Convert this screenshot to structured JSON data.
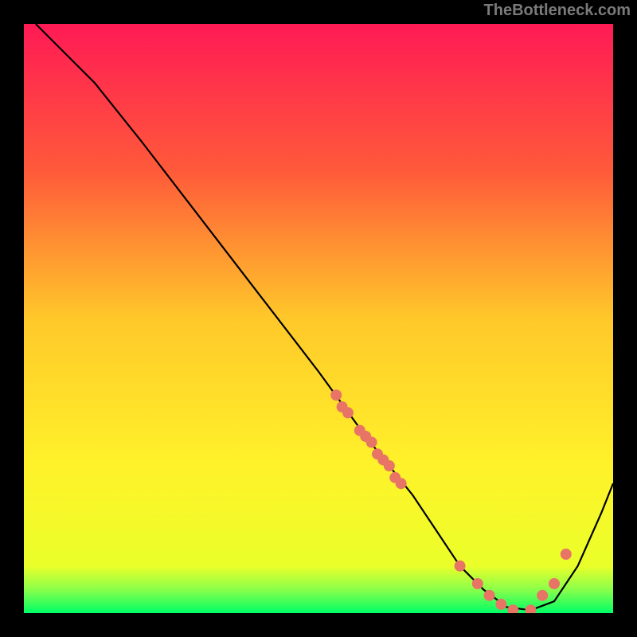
{
  "watermark": "TheBottleneck.com",
  "chart_data": {
    "type": "line",
    "title": "",
    "xlabel": "",
    "ylabel": "",
    "xlim": [
      0,
      100
    ],
    "ylim": [
      0,
      100
    ],
    "gradient_stops": [
      {
        "offset": 0,
        "color": "#ff1a55"
      },
      {
        "offset": 25,
        "color": "#ff5a3a"
      },
      {
        "offset": 50,
        "color": "#ffc82a"
      },
      {
        "offset": 75,
        "color": "#fff22a"
      },
      {
        "offset": 92,
        "color": "#eaff2a"
      },
      {
        "offset": 96,
        "color": "#8aff4a"
      },
      {
        "offset": 100,
        "color": "#00ff66"
      }
    ],
    "series": [
      {
        "name": "curve",
        "type": "line",
        "x": [
          2,
          6,
          12,
          20,
          30,
          40,
          50,
          58,
          62,
          66,
          70,
          74,
          78,
          82,
          86,
          90,
          94,
          98,
          100
        ],
        "y": [
          100,
          96,
          90,
          80,
          67,
          54,
          41,
          30,
          25,
          20,
          14,
          8,
          4,
          1,
          0.5,
          2,
          8,
          17,
          22
        ]
      },
      {
        "name": "dots",
        "type": "scatter",
        "x": [
          53,
          54,
          55,
          57,
          58,
          59,
          60,
          61,
          62,
          63,
          64,
          74,
          77,
          79,
          81,
          83,
          86,
          88,
          90,
          92
        ],
        "y": [
          37,
          35,
          34,
          31,
          30,
          29,
          27,
          26,
          25,
          23,
          22,
          8,
          5,
          3,
          1.5,
          0.5,
          0.5,
          3,
          5,
          10
        ],
        "color": "#e87466",
        "radius": 7
      }
    ]
  }
}
